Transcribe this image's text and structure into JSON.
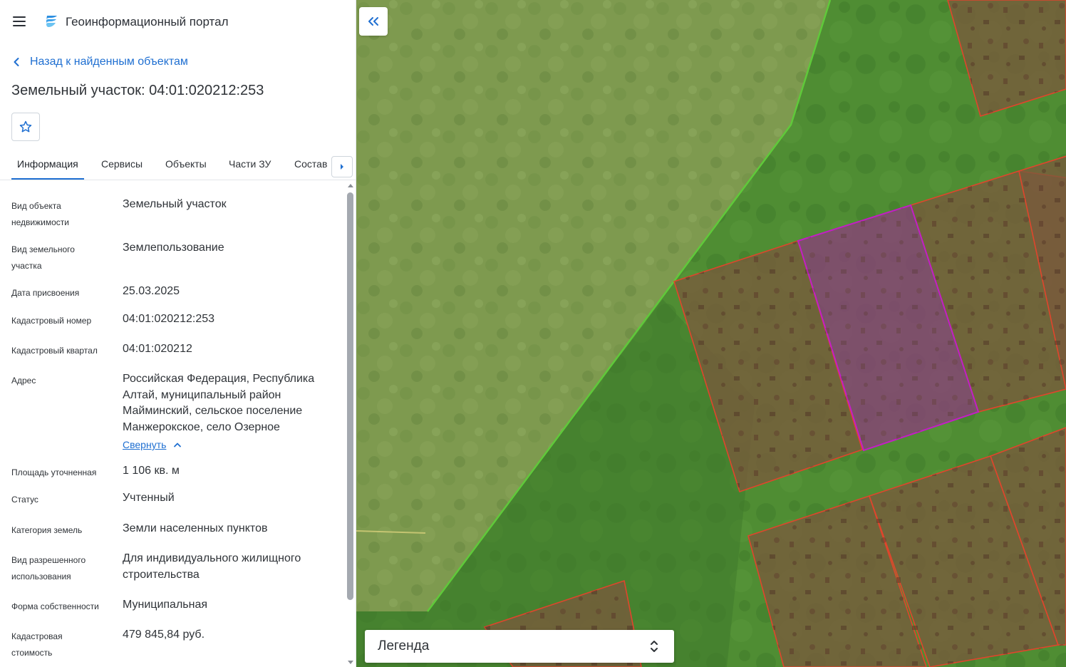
{
  "header": {
    "app_title": "Геоинформационный портал",
    "menu_icon": "hamburger-menu-icon",
    "logo_icon": "portal-logo-icon"
  },
  "nav": {
    "back_label": "Назад к найденным объектам"
  },
  "object": {
    "title": "Земельный участок: 04:01:020212:253"
  },
  "tabs": [
    {
      "label": "Информация",
      "active": true
    },
    {
      "label": "Сервисы",
      "active": false
    },
    {
      "label": "Объекты",
      "active": false
    },
    {
      "label": "Части ЗУ",
      "active": false
    },
    {
      "label": "Состав",
      "active": false
    }
  ],
  "info_rows": [
    {
      "label": "Вид объекта недвижимости",
      "value": "Земельный участок"
    },
    {
      "label": "Вид земельного участка",
      "value": "Землепользование"
    },
    {
      "label": "Дата присвоения",
      "value": "25.03.2025"
    },
    {
      "label": "Кадастровый номер",
      "value": "04:01:020212:253"
    },
    {
      "label": "Кадастровый квартал",
      "value": "04:01:020212"
    },
    {
      "label": "Адрес",
      "value": "Российская Федерация, Республика Алтай, муниципальный район Майминский, сельское поселение Манжерокское, село Озерное"
    },
    {
      "label": "Площадь уточненная",
      "value": "1 106 кв. м"
    },
    {
      "label": "Статус",
      "value": "Учтенный"
    },
    {
      "label": "Категория земель",
      "value": "Земли населенных пунктов"
    },
    {
      "label": "Вид разрешенного использования",
      "value": "Для индивидуального жилищного строительства"
    },
    {
      "label": "Форма собственности",
      "value": "Муниципальная"
    },
    {
      "label": "Кадастровая стоимость",
      "value": "479 845,84 руб."
    }
  ],
  "address_collapse_label": "Свернуть",
  "map": {
    "legend_title": "Легенда",
    "colors": {
      "parcel_border": "#e0452c",
      "selected_border": "#c21fc4",
      "boundary_line": "#5fc93a",
      "accent": "#1f6fd1"
    }
  }
}
